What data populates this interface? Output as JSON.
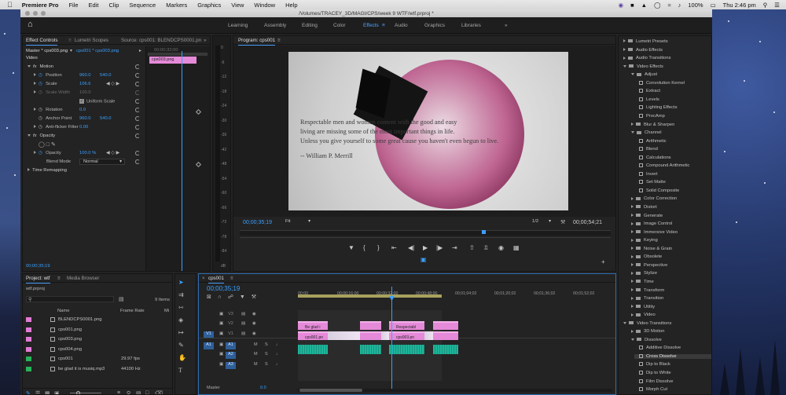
{
  "menubar": {
    "app_name": "Premiere Pro",
    "menus": [
      "File",
      "Edit",
      "Clip",
      "Sequence",
      "Markers",
      "Graphics",
      "View",
      "Window",
      "Help"
    ],
    "battery": "100%",
    "clock": "Thu 2:46 pm"
  },
  "window": {
    "title": "/Volumes/TRACEY_3D/MAGI/CPS/week 9 WTF/wtf.prproj *"
  },
  "workspaces": [
    "Learning",
    "Assembly",
    "Editing",
    "Color",
    "Effects",
    "Audio",
    "Graphics",
    "Libraries"
  ],
  "active_workspace": "Effects",
  "effect_controls": {
    "tabs": [
      "Effect Controls",
      "Lumetri Scopes",
      "Source: cps001: BLENDCPS0001.pn"
    ],
    "master": "Master * cps003.png",
    "sequence_clip": "cps001 * cps003.png",
    "mini_timecode": "00;00;32;00",
    "mini_clip": "cps003.png",
    "section_video": "Video",
    "motion": "Motion",
    "position_label": "Position",
    "position_x": "960.0",
    "position_y": "540.0",
    "scale_label": "Scale",
    "scale_value": "106.6",
    "scale_width_label": "Scale Width",
    "scale_width_value": "100.0",
    "uniform_scale": "Uniform Scale",
    "rotation_label": "Rotation",
    "rotation_value": "0.0",
    "anchor_label": "Anchor Point",
    "anchor_x": "960.0",
    "anchor_y": "540.0",
    "antiflicker_label": "Anti-flicker Filter",
    "antiflicker_value": "0.00",
    "opacity_section": "Opacity",
    "opacity_label": "Opacity",
    "opacity_value": "100.0 %",
    "blend_label": "Blend Mode",
    "blend_value": "Normal",
    "time_remap": "Time Remapping",
    "timecode": "00;00;35;19"
  },
  "audio_meter_ticks": [
    "0",
    "-6",
    "-12",
    "-18",
    "-24",
    "-30",
    "-36",
    "-42",
    "-48",
    "-54",
    "-60",
    "-66",
    "-72",
    "-78",
    "-84",
    "dB"
  ],
  "program": {
    "tab": "Program: cps001",
    "quote_line1": "Respectable men and women content with the good and easy",
    "quote_line2": "living are missing some of the most important things in life.",
    "quote_line3": "Unless you give yourself to some great cause you haven't even begun to live.",
    "quote_author": "-- William P. Merrill",
    "timecode": "00;00;35;19",
    "fit": "Fit",
    "resolution": "1/2",
    "duration": "00;00;54;21"
  },
  "effects_panel": {
    "items": [
      {
        "label": "Lumetri Presets",
        "type": "folder",
        "indent": 0
      },
      {
        "label": "Audio Effects",
        "type": "folder",
        "indent": 0
      },
      {
        "label": "Audio Transitions",
        "type": "folder",
        "indent": 0
      },
      {
        "label": "Video Effects",
        "type": "folder-open",
        "indent": 0
      },
      {
        "label": "Adjust",
        "type": "folder-open",
        "indent": 1
      },
      {
        "label": "Convolution Kernel",
        "type": "fx",
        "indent": 2
      },
      {
        "label": "Extract",
        "type": "fx",
        "indent": 2
      },
      {
        "label": "Levels",
        "type": "fx",
        "indent": 2
      },
      {
        "label": "Lighting Effects",
        "type": "fx",
        "indent": 2
      },
      {
        "label": "ProcAmp",
        "type": "fx",
        "indent": 2
      },
      {
        "label": "Blur & Sharpen",
        "type": "folder",
        "indent": 1
      },
      {
        "label": "Channel",
        "type": "folder-open",
        "indent": 1
      },
      {
        "label": "Arithmetic",
        "type": "fx",
        "indent": 2
      },
      {
        "label": "Blend",
        "type": "fx",
        "indent": 2
      },
      {
        "label": "Calculations",
        "type": "fx",
        "indent": 2
      },
      {
        "label": "Compound Arithmetic",
        "type": "fx",
        "indent": 2
      },
      {
        "label": "Invert",
        "type": "fx",
        "indent": 2
      },
      {
        "label": "Set Matte",
        "type": "fx",
        "indent": 2
      },
      {
        "label": "Solid Composite",
        "type": "fx",
        "indent": 2
      },
      {
        "label": "Color Correction",
        "type": "folder",
        "indent": 1
      },
      {
        "label": "Distort",
        "type": "folder",
        "indent": 1
      },
      {
        "label": "Generate",
        "type": "folder",
        "indent": 1
      },
      {
        "label": "Image Control",
        "type": "folder",
        "indent": 1
      },
      {
        "label": "Immersive Video",
        "type": "folder",
        "indent": 1
      },
      {
        "label": "Keying",
        "type": "folder",
        "indent": 1
      },
      {
        "label": "Noise & Grain",
        "type": "folder",
        "indent": 1
      },
      {
        "label": "Obsolete",
        "type": "folder",
        "indent": 1
      },
      {
        "label": "Perspective",
        "type": "folder",
        "indent": 1
      },
      {
        "label": "Stylize",
        "type": "folder",
        "indent": 1
      },
      {
        "label": "Time",
        "type": "folder",
        "indent": 1
      },
      {
        "label": "Transform",
        "type": "folder",
        "indent": 1
      },
      {
        "label": "Transition",
        "type": "folder",
        "indent": 1
      },
      {
        "label": "Utility",
        "type": "folder",
        "indent": 1
      },
      {
        "label": "Video",
        "type": "folder",
        "indent": 1
      },
      {
        "label": "Video Transitions",
        "type": "folder-open",
        "indent": 0
      },
      {
        "label": "3D Motion",
        "type": "folder",
        "indent": 1
      },
      {
        "label": "Dissolve",
        "type": "folder-open",
        "indent": 1
      },
      {
        "label": "Additive Dissolve",
        "type": "fx",
        "indent": 2
      },
      {
        "label": "Cross Dissolve",
        "type": "fx-selected",
        "indent": 2
      },
      {
        "label": "Dip to Black",
        "type": "fx",
        "indent": 2
      },
      {
        "label": "Dip to White",
        "type": "fx",
        "indent": 2
      },
      {
        "label": "Film Dissolve",
        "type": "fx",
        "indent": 2
      },
      {
        "label": "Morph Cut",
        "type": "fx",
        "indent": 2
      }
    ]
  },
  "project": {
    "tabs": [
      "Project: wtf",
      "Media Browser"
    ],
    "file": "wtf.prproj",
    "count": "9 Items",
    "col_name": "Name",
    "col_rate": "Frame Rate",
    "col_media": "Mi",
    "rows": [
      {
        "name": "BLENDCPS0001.png",
        "rate": "",
        "color": "#e27ad6"
      },
      {
        "name": "cps001.png",
        "rate": "",
        "color": "#e27ad6"
      },
      {
        "name": "cps003.png",
        "rate": "",
        "color": "#e27ad6"
      },
      {
        "name": "cps004.png",
        "rate": "",
        "color": "#e27ad6"
      },
      {
        "name": "cps001",
        "rate": "29.97 fps",
        "color": "#27b35a"
      },
      {
        "name": "be glad it is musiq.mp3",
        "rate": "44100 Hz",
        "color": "#27b35a"
      }
    ]
  },
  "timeline": {
    "tab": "cps001",
    "timecode": "00;00;35;19",
    "ruler": [
      "00;00",
      "00;00;16;00",
      "00;00;32;00",
      "00;00;48;00",
      "00;01;04;02",
      "00;01;20;02",
      "00;01;36;02",
      "00;01;52;02"
    ],
    "video_tracks": [
      "V3",
      "V2",
      "V1"
    ],
    "audio_tracks": [
      "A1",
      "A2",
      "A3"
    ],
    "source_patch_video": "V1",
    "source_patch_audio": "A1",
    "master_label": "Master",
    "master_value": "0.0",
    "v2_clips": [
      "Be glad i",
      "",
      "Respectabl",
      ""
    ],
    "v1_clips": [
      "cps001.pn",
      "",
      "cps003.pn",
      ""
    ]
  },
  "colors": {
    "accent": "#3aa0ff",
    "video_clip": "#e58ad8",
    "audio_clip": "#1fb59a",
    "playhead": "#3aa0ff"
  }
}
